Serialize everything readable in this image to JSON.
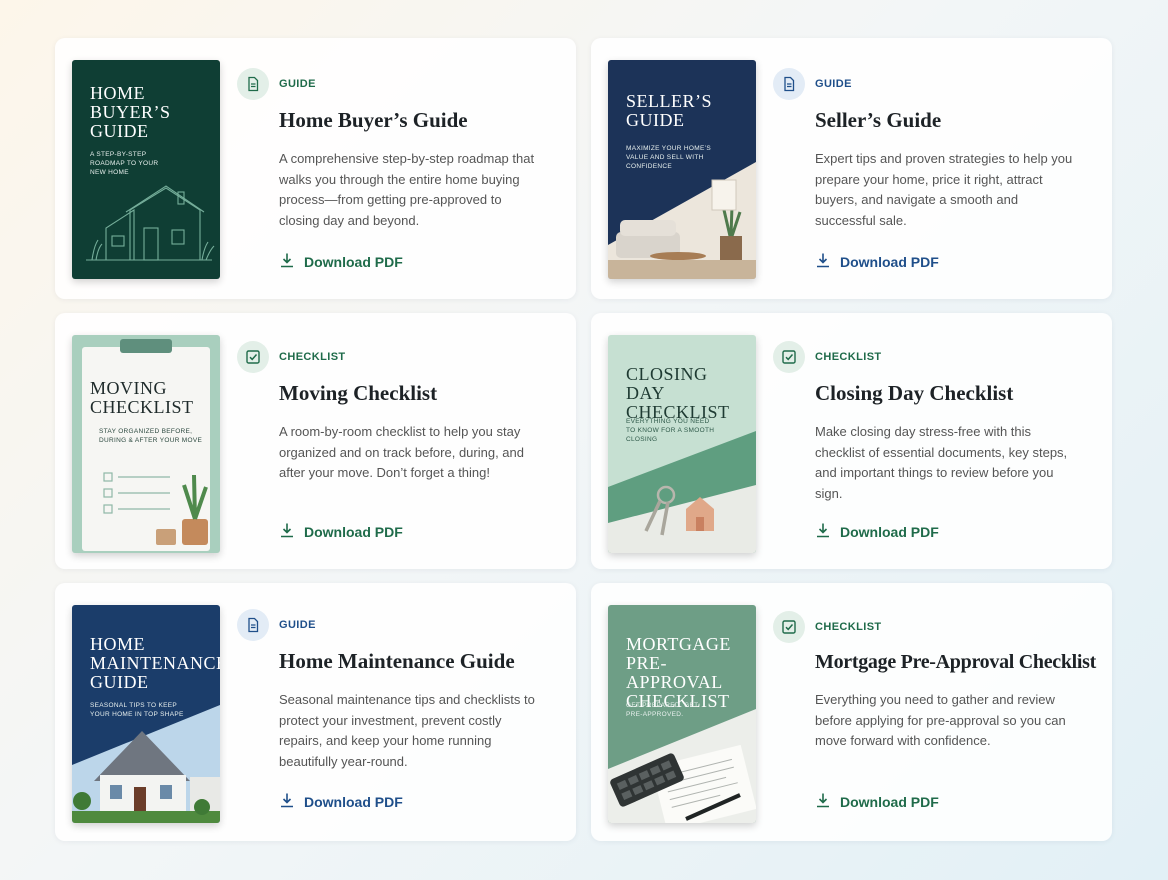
{
  "cards": [
    {
      "tag": "GUIDE",
      "title": "Home Buyer’s Guide",
      "description": "A comprehensive step-by-step roadmap that walks you through the entire home buying process—from getting pre-approved to closing day and beyond.",
      "download_label": "Download PDF",
      "cover_title": "HOME\nBUYER’S\nGUIDE",
      "cover_subtitle": "A STEP-BY-STEP\nROADMAP TO YOUR\nNEW HOME",
      "icon": "document-icon",
      "accent": "#1f6b4a"
    },
    {
      "tag": "GUIDE",
      "title": "Seller’s Guide",
      "description": "Expert tips and proven strategies to help you prepare your home, price it right, attract buyers, and navigate a smooth and successful sale.",
      "download_label": "Download PDF",
      "cover_title": "SELLER’S\nGUIDE",
      "cover_subtitle": "MAXIMIZE YOUR HOME’S\nVALUE AND SELL WITH\nCONFIDENCE",
      "icon": "document-icon",
      "accent": "#1f4f8a"
    },
    {
      "tag": "CHECKLIST",
      "title": "Moving Checklist",
      "description": "A room-by-room checklist to help you stay organized and on track before, during, and after your move. Don’t forget a thing!",
      "download_label": "Download PDF",
      "cover_title": "MOVING\nCHECKLIST",
      "cover_subtitle": "STAY ORGANIZED BEFORE,\nDURING & AFTER YOUR MOVE",
      "icon": "checkbox-icon",
      "accent": "#1f6b4a"
    },
    {
      "tag": "CHECKLIST",
      "title": "Closing Day Checklist",
      "description": "Make closing day stress-free with this checklist of essential documents, key steps, and important things to review before you sign.",
      "download_label": "Download PDF",
      "cover_title": "CLOSING DAY\nCHECKLIST",
      "cover_subtitle": "EVERYTHING YOU NEED\nTO KNOW FOR A SMOOTH\nCLOSING",
      "icon": "checkbox-icon",
      "accent": "#1f6b4a"
    },
    {
      "tag": "GUIDE",
      "title": "Home Maintenance Guide",
      "description": "Seasonal maintenance tips and checklists to protect your investment, prevent costly repairs, and keep your home running beautifully year-round.",
      "download_label": "Download PDF",
      "cover_title": "HOME\nMAINTENANCE\nGUIDE",
      "cover_subtitle": "SEASONAL TIPS TO KEEP\nYOUR HOME IN TOP SHAPE",
      "icon": "document-icon",
      "accent": "#1f4f8a"
    },
    {
      "tag": "CHECKLIST",
      "title": "Mortgage Pre-Approval Checklist",
      "description": "Everything you need to gather and review before applying for pre-approval so you can move forward with confidence.",
      "download_label": "Download PDF",
      "cover_title": "MORTGAGE\nPRE-APPROVAL\nCHECKLIST",
      "cover_subtitle": "GET PREPARED. GET\nPRE-APPROVED.",
      "icon": "checkbox-icon",
      "accent": "#1f6b4a"
    }
  ]
}
